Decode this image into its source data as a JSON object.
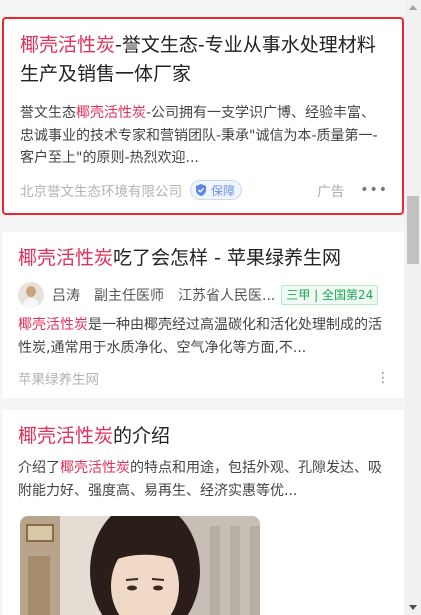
{
  "ad": {
    "title_hl": "椰壳活性炭",
    "title_rest": "-誉文生态-专业从事水处理材料生产及销售一体厂家",
    "desc_pre": "誉文生态",
    "desc_hl": "椰壳活性炭",
    "desc_rest": "-公司拥有一支学识广博、经验丰富、忠诚事业的技术专家和营销团队-秉承\"诚信为本-质量第一-客户至上\"的原则-热烈欢迎...",
    "source": "北京誉文生态环境有限公司",
    "badge": "保障",
    "ad_label": "广告",
    "more": "•••"
  },
  "result2": {
    "title_hl": "椰壳活性炭",
    "title_rest": "吃了会怎样 - 苹果绿养生网",
    "doctor_name": "吕涛",
    "doctor_title": "副主任医师",
    "hospital": "江苏省人民医...",
    "hospital_tag": "三甲 | 全国第24",
    "desc_hl": "椰壳活性炭",
    "desc_rest": "是一种由椰壳经过高温碳化和活化处理制成的活性炭,通常用于水质净化、空气净化等方面,不...",
    "source": "苹果绿养生网",
    "more": "⋮"
  },
  "result3": {
    "title_hl": "椰壳活性炭",
    "title_rest": "的介绍",
    "desc_pre": "介绍了",
    "desc_hl": "椰壳活性炭",
    "desc_rest": "的特点和用途，包括外观、孔隙发达、吸附能力好、强度高、易再生、经济实惠等优..."
  },
  "colors": {
    "highlight": "#e0315a",
    "ad_border": "#f0262e",
    "tag_green": "#1fa85a",
    "badge_blue": "#6f93e8"
  },
  "icons": [
    "shield-check-icon",
    "more-dots-icon",
    "more-vertical-icon",
    "doctor-avatar",
    "scroll-up-arrow",
    "scroll-down-arrow"
  ]
}
